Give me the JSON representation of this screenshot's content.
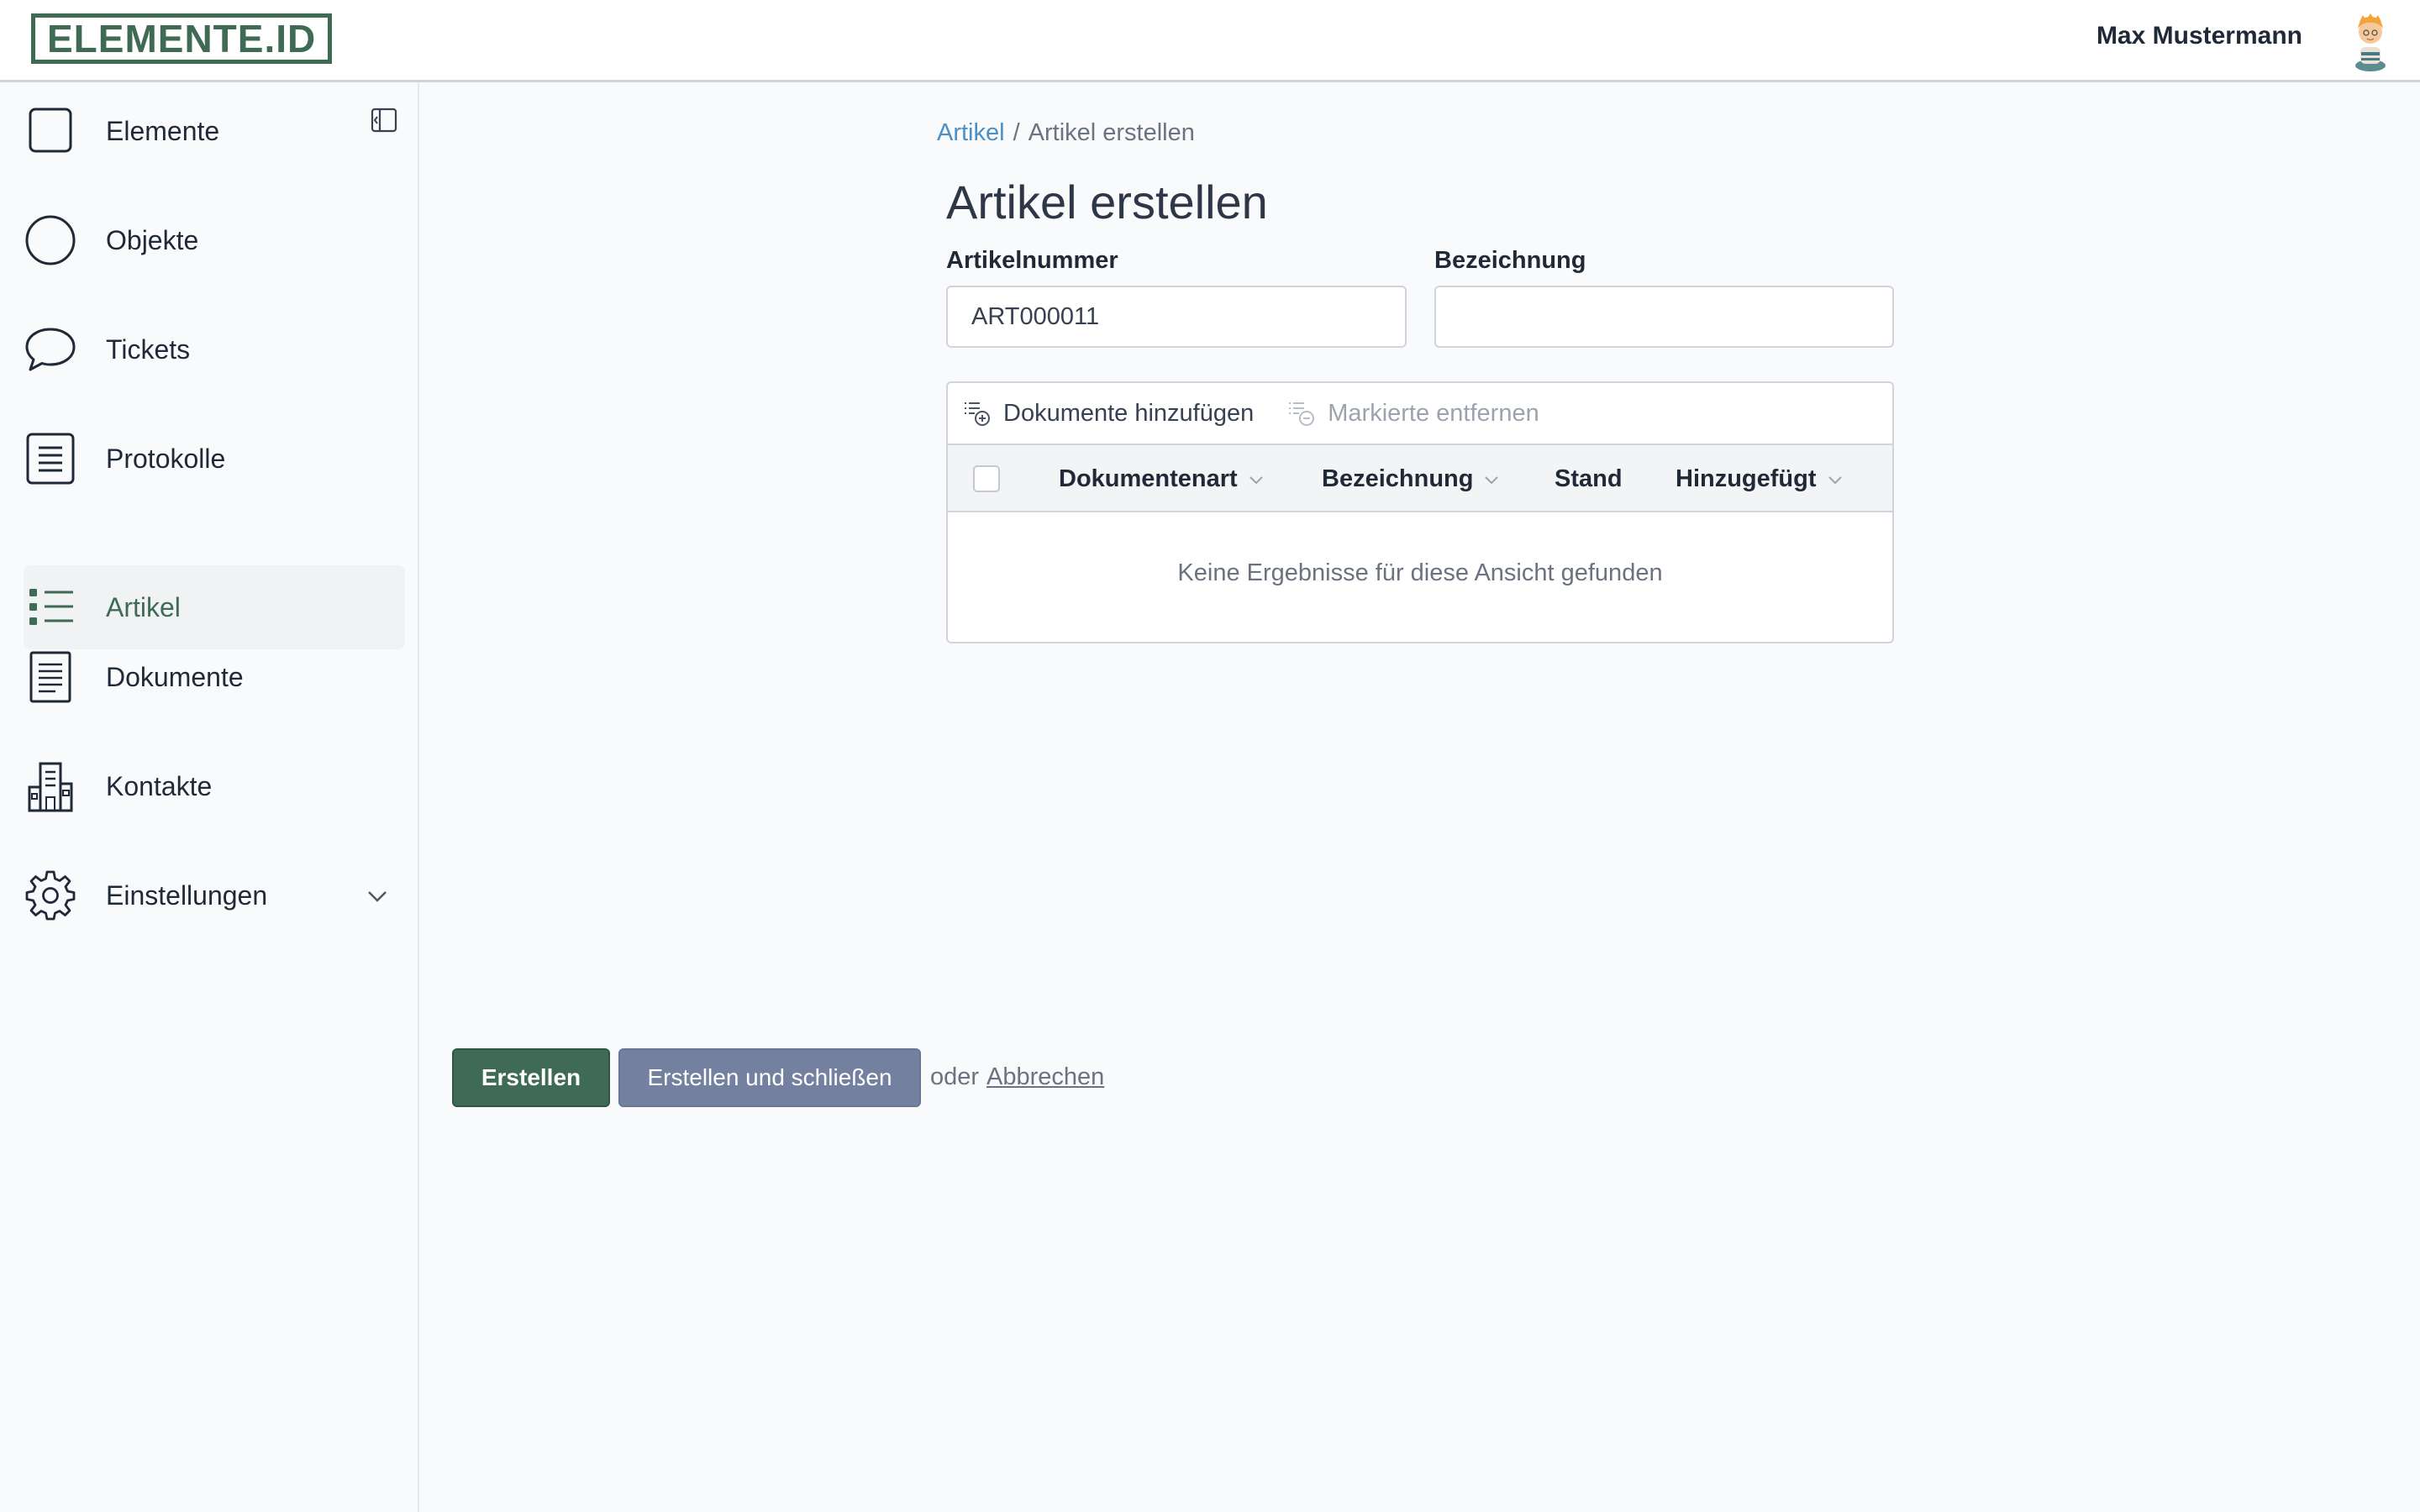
{
  "header": {
    "logo_text": "ELEMENTE.ID",
    "user_name": "Max Mustermann"
  },
  "sidebar": {
    "items": [
      {
        "label": "Elemente",
        "icon": "square-icon"
      },
      {
        "label": "Objekte",
        "icon": "circle-icon"
      },
      {
        "label": "Tickets",
        "icon": "speech-bubble-icon"
      },
      {
        "label": "Protokolle",
        "icon": "protocol-list-icon"
      },
      {
        "label": "Artikel",
        "icon": "bullet-list-icon",
        "active": true
      },
      {
        "label": "Dokumente",
        "icon": "document-icon"
      },
      {
        "label": "Kontakte",
        "icon": "buildings-icon"
      },
      {
        "label": "Einstellungen",
        "icon": "gear-icon",
        "expandable": true
      }
    ]
  },
  "breadcrumb": {
    "parent": "Artikel",
    "separator": "/",
    "current": "Artikel erstellen"
  },
  "page": {
    "title": "Artikel erstellen"
  },
  "form": {
    "artikelnummer_label": "Artikelnummer",
    "artikelnummer_value": "ART000011",
    "bezeichnung_label": "Bezeichnung",
    "bezeichnung_value": ""
  },
  "documents": {
    "add_label": "Dokumente hinzufügen",
    "remove_label": "Markierte entfernen",
    "columns": [
      "Dokumentenart",
      "Bezeichnung",
      "Stand",
      "Hinzugefügt"
    ],
    "empty_message": "Keine Ergebnisse für diese Ansicht gefunden"
  },
  "actions": {
    "create_label": "Erstellen",
    "create_close_label": "Erstellen und schließen",
    "or_text": "oder",
    "cancel_label": "Abbrechen"
  },
  "colors": {
    "brand": "#3f6b55",
    "secondary_button": "#7480a0",
    "link": "#4a90c6"
  }
}
